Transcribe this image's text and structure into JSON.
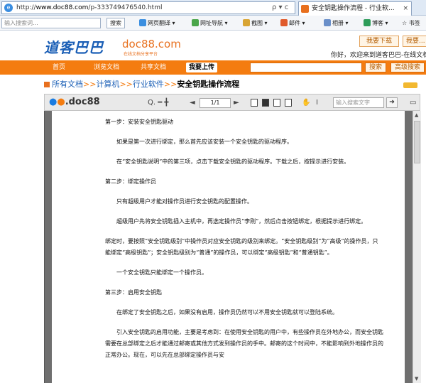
{
  "browser": {
    "url_prefix": "http://",
    "url_host": "www.doc88.com",
    "url_path": "/p-333749476540.html",
    "nav_icons": "ρ ▾ ϲ",
    "tab_title": "安全钥匙操作流程 - 行业软...",
    "tab_close": "×"
  },
  "toolbar": {
    "search_placeholder": "输入搜索词...",
    "search_button": "搜索",
    "items": [
      "网页翻译 ▾",
      "网址导航 ▾",
      "截图 ▾",
      "邮件 ▾",
      "相册 ▾",
      "博客 ▾",
      "☆ 书签"
    ]
  },
  "site": {
    "logo_cn": "道客巴巴",
    "logo_domain": "doc88.com",
    "logo_tag": "在线文档分享平台",
    "download_btn": "我要下载",
    "download_btn2": "我要...",
    "welcome": "你好，欢迎来到道客巴巴-在线文档"
  },
  "nav": {
    "items": [
      "首页",
      "浏览文档",
      "共享文档"
    ],
    "upload": "我要上传",
    "search_btn": "搜索",
    "adv_search_btn": "高级搜索"
  },
  "breadcrumb": {
    "items": [
      "所有文档",
      "计算机",
      "行业软件"
    ],
    "sep": ">>",
    "current": "安全钥匙操作流程"
  },
  "viewer": {
    "logo_mid": ".doc88",
    "zoom_icons": "Q. ━ ╋",
    "page_indicator": "1/1",
    "find_placeholder": "输入搜索文字"
  },
  "document": {
    "paragraphs": [
      {
        "text": "第一步：安装安全钥匙驱动",
        "indent": false
      },
      {
        "text": "如果是第一次进行绑定，那么首先应该安装一个安全钥匙的驱动程序。",
        "indent": true
      },
      {
        "text": "在“安全钥匙说明”中的第三项，点击下载安全钥匙的驱动程序。下载之后，按提示进行安装。",
        "indent": true
      },
      {
        "text": "第二步：绑定操作员",
        "indent": false
      },
      {
        "text": "只有超级用户才能对操作员进行安全钥匙的配置操作。",
        "indent": true
      },
      {
        "text": "超级用户先将安全钥匙插入主机中，再选定操作员“李刚”，然后点击按钮绑定，根据提示进行绑定。",
        "indent": true
      },
      {
        "text": "绑定时，要按照“安全钥匙级别”中操作员对应安全钥匙的级别来绑定。“安全钥匙级别”为“高级”的操作员，只能绑定“高级钥匙”；安全钥匙级别为“普通”的操作员，可以绑定“高级钥匙”和“普通钥匙”。",
        "indent": false
      },
      {
        "text": "一个安全钥匙只能绑定一个操作员。",
        "indent": true
      },
      {
        "text": "第三步：启用安全钥匙",
        "indent": false
      },
      {
        "text": "在绑定了安全钥匙之后，如果没有启用，操作员仍然可以不用安全钥匙就可以登陆系统。",
        "indent": true
      },
      {
        "text": "引入安全钥匙的启用功能，主要是考虑到：在使用安全钥匙的用户中，有些操作员在外地办公，而安全钥匙需要在总部绑定之后才能通过邮寄或其他方式发到操作员的手中。邮寄的这个时间中，不能影响到外地操作员的正常办公。现在，可以先在总部绑定操作员与安",
        "indent": true
      }
    ]
  }
}
